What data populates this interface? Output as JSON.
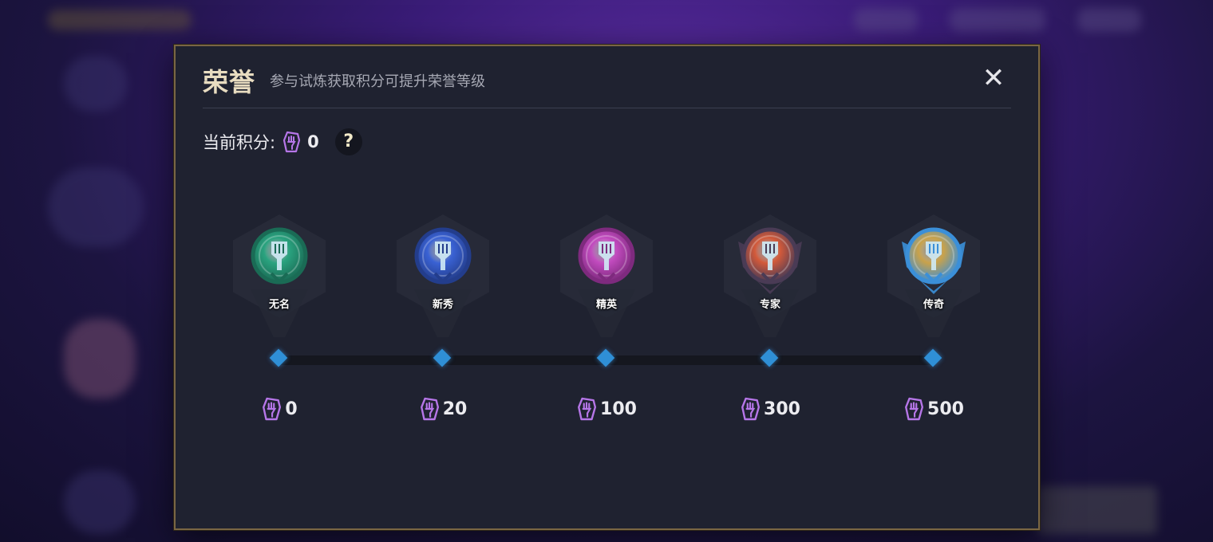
{
  "dialog": {
    "title": "荣誉",
    "subtitle": "参与试炼获取积分可提升荣誉等级",
    "close_label": "✕"
  },
  "score": {
    "label": "当前积分:",
    "value": "0",
    "help_label": "?"
  },
  "colors": {
    "token": "#b676e8",
    "node": "#2f8fd6",
    "frame": "#7a6644"
  },
  "tiers": [
    {
      "name": "无名",
      "requirement": "0",
      "color": "#2aa37f",
      "rim": "#1a6b55",
      "icon": "spatula-emblem-icon"
    },
    {
      "name": "新秀",
      "requirement": "20",
      "color": "#3a62d4",
      "rim": "#233d8c",
      "icon": "spatula-emblem-icon"
    },
    {
      "name": "精英",
      "requirement": "100",
      "color": "#c24bbf",
      "rim": "#7e2a7e",
      "icon": "spatula-emblem-icon"
    },
    {
      "name": "专家",
      "requirement": "300",
      "color": "#d35a3a",
      "rim": "#4a3b55",
      "icon": "spatula-emblem-icon"
    },
    {
      "name": "传奇",
      "requirement": "500",
      "color": "#c9a24a",
      "rim": "#3b8fd8",
      "icon": "spatula-emblem-icon"
    }
  ]
}
